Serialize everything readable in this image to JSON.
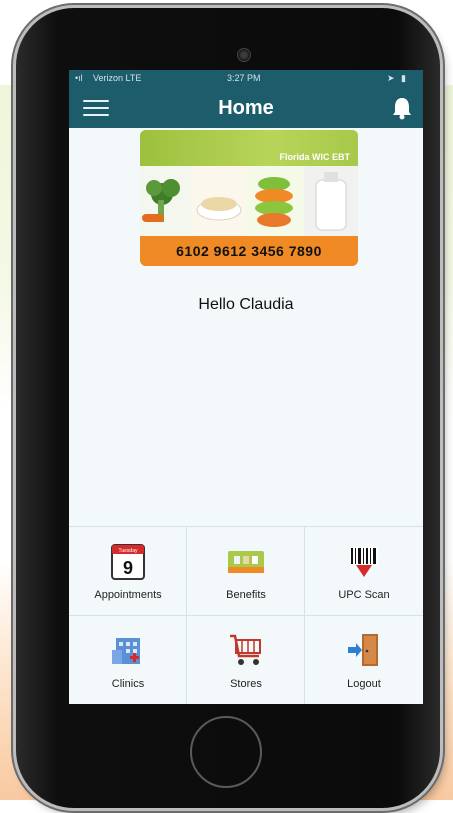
{
  "status_bar": {
    "carrier": "Verizon  LTE",
    "time": "3:27 PM"
  },
  "header": {
    "title": "Home",
    "menu_icon": "hamburger-menu-icon",
    "notification_icon": "bell-icon"
  },
  "wic_card": {
    "brand": "Florida WIC EBT",
    "number": "6102 9612 3456 7890"
  },
  "greeting": "Hello Claudia",
  "tiles": [
    {
      "label": "Appointments",
      "icon": "calendar-icon",
      "calendar_header": "Tuesday",
      "calendar_day": "9"
    },
    {
      "label": "Benefits",
      "icon": "benefits-card-icon"
    },
    {
      "label": "UPC Scan",
      "icon": "barcode-scan-icon"
    },
    {
      "label": "Clinics",
      "icon": "clinic-building-icon"
    },
    {
      "label": "Stores",
      "icon": "shopping-cart-icon"
    },
    {
      "label": "Logout",
      "icon": "logout-door-icon"
    }
  ],
  "colors": {
    "header_bg": "#1d5d6b",
    "card_accent": "#f08a24",
    "card_green": "#a9c94a",
    "screen_bg": "#f3f8fa"
  }
}
